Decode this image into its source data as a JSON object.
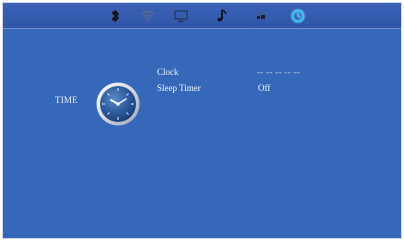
{
  "section": {
    "title": "TIME"
  },
  "settings": [
    {
      "label": "Clock",
      "value": "-- -- --   -- --"
    },
    {
      "label": "Sleep Timer",
      "value": "Off"
    }
  ],
  "topbar": {
    "icons": [
      {
        "name": "bluetooth-icon",
        "active": false
      },
      {
        "name": "wifi-icon",
        "active": false
      },
      {
        "name": "display-icon",
        "active": false
      },
      {
        "name": "music-icon",
        "active": false
      },
      {
        "name": "source-icon",
        "active": false
      },
      {
        "name": "clock-icon",
        "active": true
      }
    ]
  },
  "colors": {
    "background": "#3568b8",
    "topbar": "#2f56a7",
    "active_icon": "#35c7ff",
    "text": "#f2f5ff"
  }
}
